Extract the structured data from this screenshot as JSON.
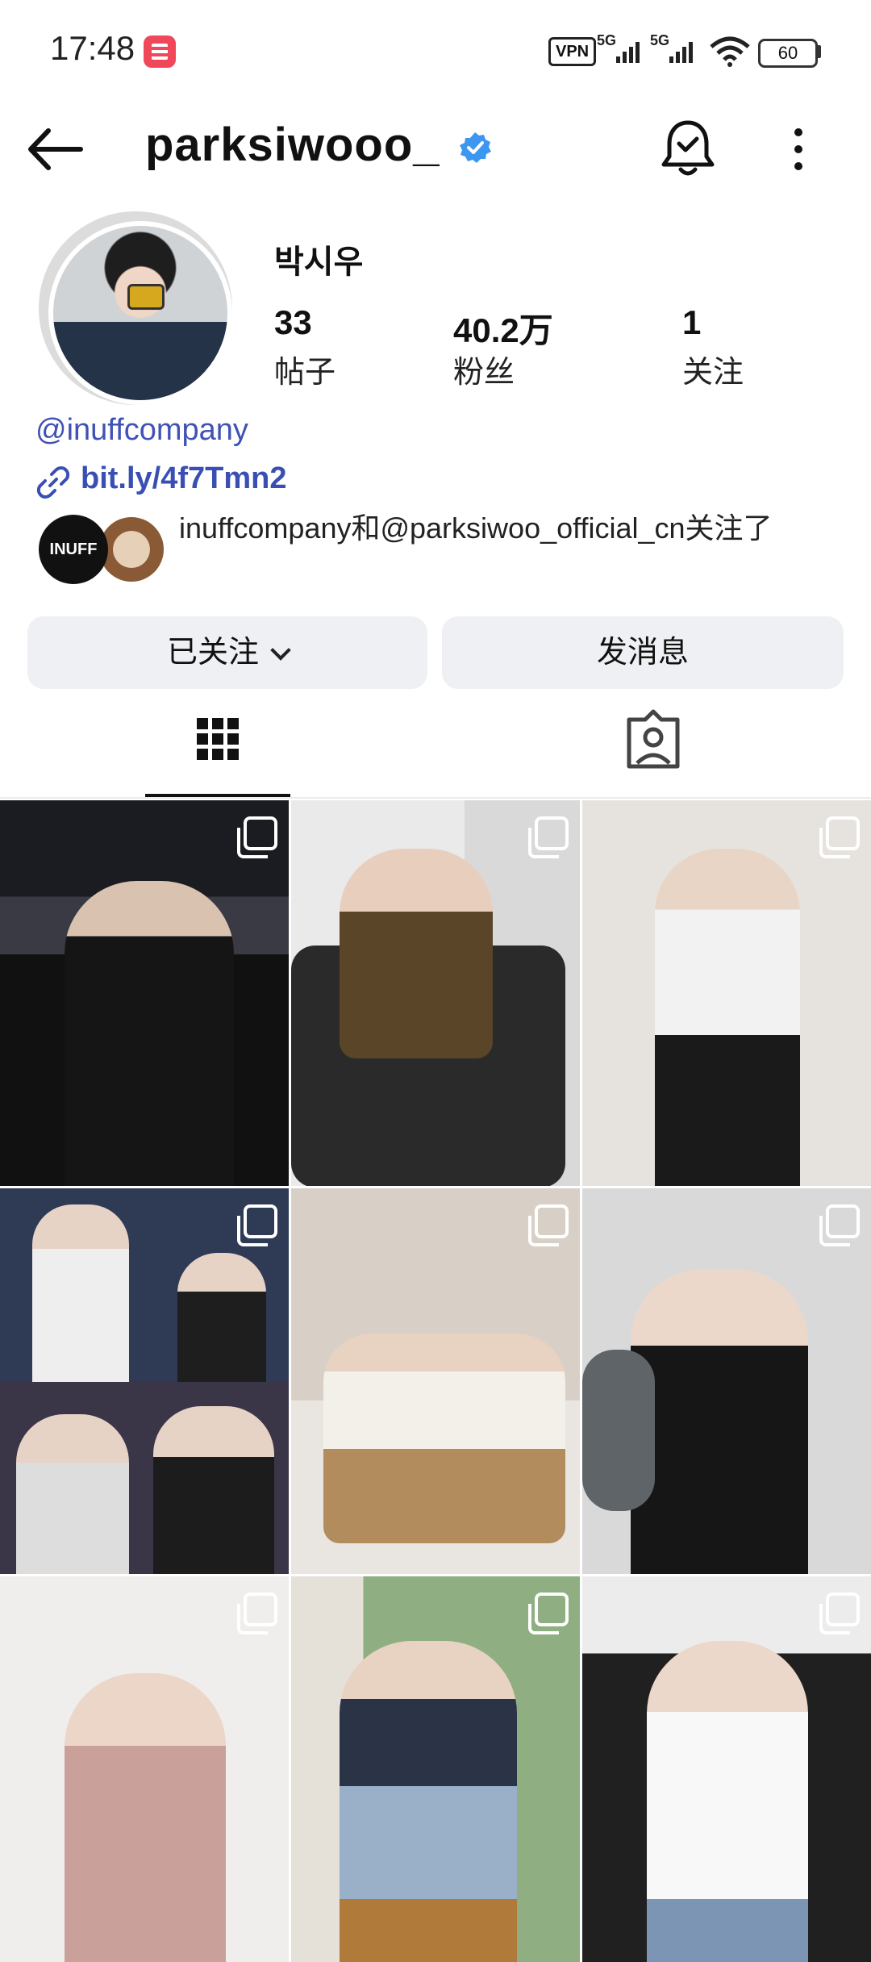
{
  "status_bar": {
    "time": "17:48",
    "vpn_label": "VPN",
    "network_1": "5G",
    "network_2": "5G",
    "battery": "60"
  },
  "header": {
    "username": "parksiwooo_",
    "verified": true
  },
  "profile": {
    "name": "박시우",
    "stats": [
      {
        "value": "33",
        "label": "帖子"
      },
      {
        "value": "40.2万",
        "label": "粉丝"
      },
      {
        "value": "1",
        "label": "关注"
      }
    ],
    "threads_handle": "inuffcompany",
    "link": "bit.ly/4f7Tmn2",
    "followed_by_text": "inuffcompany和@parksiwoo_official_cn关注了",
    "follower_avatar_1_label": "INUFF"
  },
  "actions": {
    "follow_button": "已关注",
    "message_button": "发消息"
  },
  "tabs": [
    {
      "name": "posts-grid",
      "selected": true
    },
    {
      "name": "tagged",
      "selected": false
    }
  ],
  "colors": {
    "link": "#3a4fb3",
    "verified": "#3b97f0",
    "button_bg": "#eef0f3"
  },
  "posts": [
    {
      "multi": true
    },
    {
      "multi": true
    },
    {
      "multi": true
    },
    {
      "multi": true
    },
    {
      "multi": true
    },
    {
      "multi": true
    },
    {
      "multi": true
    },
    {
      "multi": true
    },
    {
      "multi": true
    }
  ]
}
